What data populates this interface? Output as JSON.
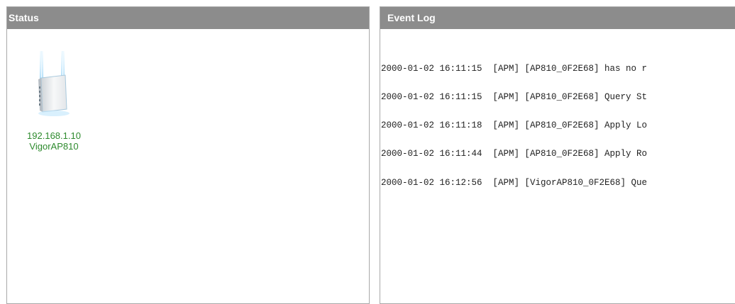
{
  "status_panel": {
    "title": "Status",
    "device": {
      "icon": "access-point-icon",
      "ip": "192.168.1.10",
      "name": "VigorAP810"
    }
  },
  "event_log_panel": {
    "title": "Event Log",
    "lines": [
      "2000-01-02 16:11:15  [APM] [AP810_0F2E68] has no r",
      "2000-01-02 16:11:15  [APM] [AP810_0F2E68] Query St",
      "2000-01-02 16:11:18  [APM] [AP810_0F2E68] Apply Lo",
      "2000-01-02 16:11:44  [APM] [AP810_0F2E68] Apply Ro",
      "2000-01-02 16:12:56  [APM] [VigorAP810_0F2E68] Que"
    ]
  },
  "colors": {
    "header_bg": "#8c8c8c",
    "device_text": "#2d8a2d"
  }
}
